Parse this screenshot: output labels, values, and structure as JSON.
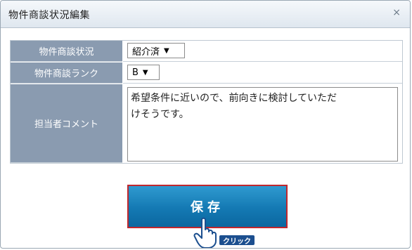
{
  "dialog": {
    "title": "物件商談状況編集",
    "close_label": "×"
  },
  "form": {
    "status": {
      "label": "物件商談状況",
      "value": "紹介済"
    },
    "rank": {
      "label": "物件商談ランク",
      "value": "B"
    },
    "comment": {
      "label": "担当者コメント",
      "value": "希望条件に近いので、前向きに検討していただ\nけそうです。"
    }
  },
  "actions": {
    "save_label": "保存",
    "click_hint": "クリック"
  },
  "icons": {
    "close": "close-icon",
    "dropdown": "chevron-down-icon",
    "pointer": "hand-pointer-icon"
  },
  "colors": {
    "label_bg": "#8a9bb0",
    "save_bg": "#1479b3",
    "save_border": "#c0272d"
  }
}
